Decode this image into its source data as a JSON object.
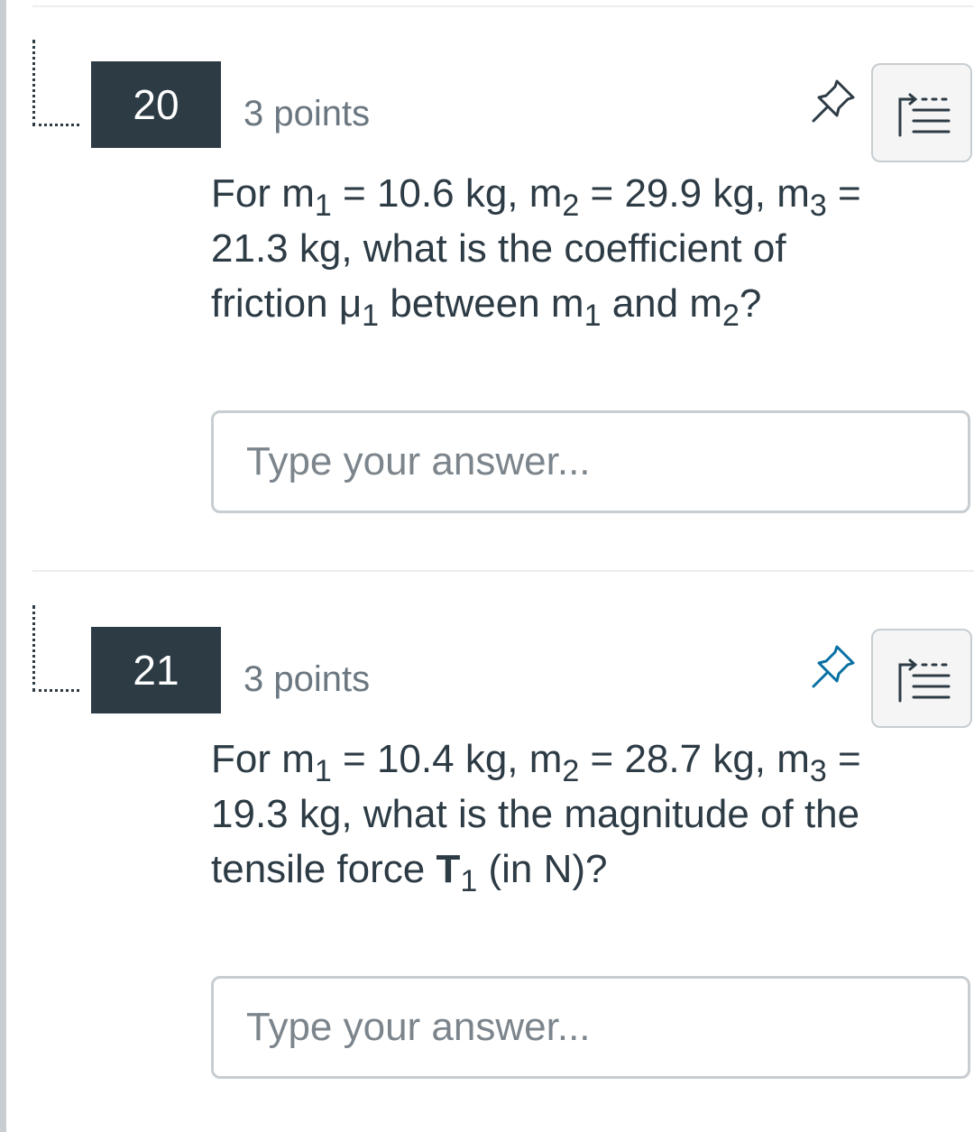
{
  "questions": [
    {
      "number": "20",
      "points": "3 points",
      "pinned": false,
      "text": {
        "l1_a": "For m",
        "l1_s1": "1",
        "l1_b": " = 10.6 kg,  m",
        "l1_s2": "2",
        "l1_c": " = 29.9 kg,  m",
        "l1_s3": "3",
        "l1_d": " =",
        "l2": "21.3 kg, what is the coefficient of",
        "l3_a": "friction μ",
        "l3_s1": "1",
        "l3_b": " between m",
        "l3_s2": "1",
        "l3_c": " and m",
        "l3_s3": "2",
        "l3_d": "?"
      },
      "answer": {
        "value": "",
        "placeholder": "Type your answer..."
      }
    },
    {
      "number": "21",
      "points": "3 points",
      "pinned": true,
      "text": {
        "l1_a": "For m",
        "l1_s1": "1",
        "l1_b": " = 10.4 kg,  m",
        "l1_s2": "2",
        "l1_c": " = 28.7 kg,  m",
        "l1_s3": "3",
        "l1_d": " =",
        "l2": "19.3 kg, what is the magnitude of the",
        "l3_a": "tensile force ",
        "l3_bold": "T",
        "l3_s1": "1",
        "l3_b": " (in N)?"
      },
      "answer": {
        "value": "",
        "placeholder": "Type your answer..."
      }
    }
  ],
  "icons": {
    "pin": "pushpin-icon",
    "outline": "outline-list-icon",
    "handle": "drag-handle-icon"
  },
  "colors": {
    "badge_bg": "#2d3b45",
    "pin_default": "#2d3b45",
    "pin_active": "#0770a3",
    "border": "#c7cdd1"
  }
}
